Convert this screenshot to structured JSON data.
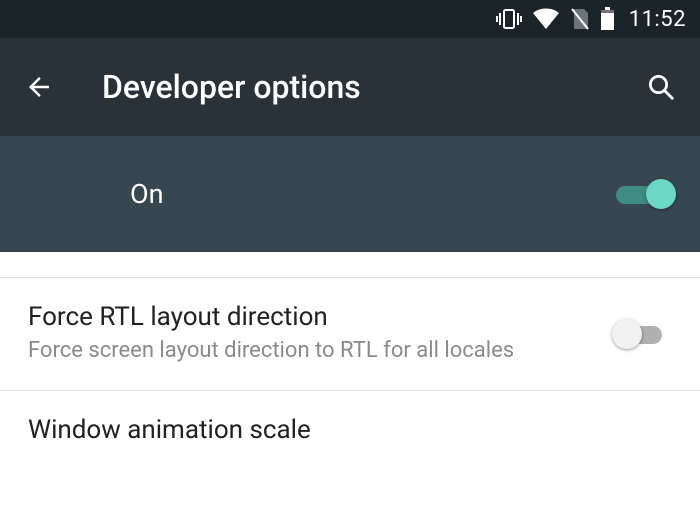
{
  "statusbar": {
    "time": "11:52"
  },
  "appbar": {
    "title": "Developer options"
  },
  "master_toggle": {
    "label": "On",
    "state": "on"
  },
  "settings": [
    {
      "title": "Force RTL layout direction",
      "subtitle": "Force screen layout direction to RTL for all locales",
      "switch_state": "off"
    },
    {
      "title": "Window animation scale",
      "subtitle": ""
    }
  ],
  "colors": {
    "statusbar_bg": "#1b2428",
    "appbar_bg": "#283238",
    "master_bg": "#37474f",
    "accent": "#6ad7c7"
  }
}
